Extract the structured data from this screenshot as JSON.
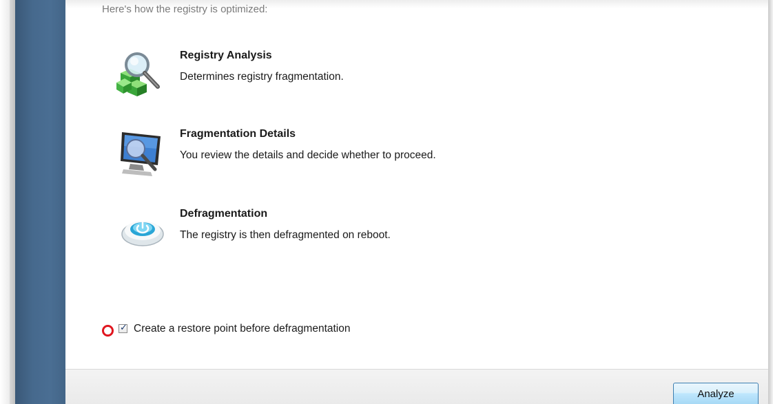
{
  "intro": {
    "text": "Here's how the registry is optimized:"
  },
  "steps": [
    {
      "icon": "registry-analysis-icon",
      "title": "Registry Analysis",
      "description": "Determines registry fragmentation."
    },
    {
      "icon": "fragmentation-details-monitor-icon",
      "title": "Fragmentation Details",
      "description": "You review the details and decide whether to proceed."
    },
    {
      "icon": "defragmentation-power-icon",
      "title": "Defragmentation",
      "description": "The registry is then defragmented on reboot."
    }
  ],
  "restore_point": {
    "label": "Create a restore point before defragmentation",
    "checked": true,
    "check_glyph": "✓"
  },
  "footer": {
    "analyze_label": "Analyze"
  },
  "colors": {
    "sidebar": "#46698d",
    "marker": "#e0161f",
    "button_border": "#3c7fb1"
  }
}
